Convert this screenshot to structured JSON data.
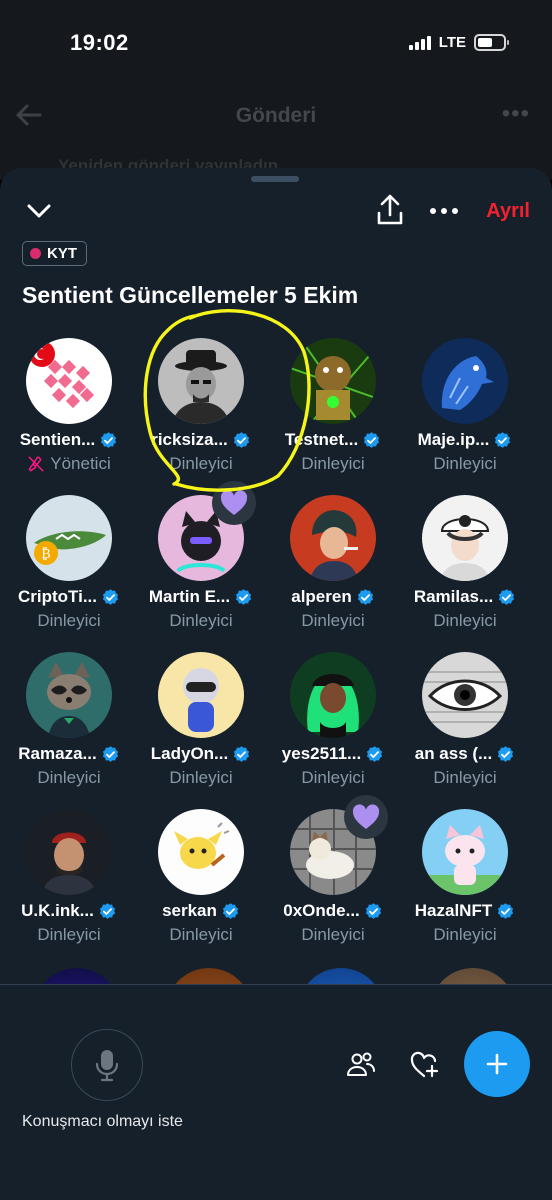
{
  "status_bar": {
    "time": "19:02",
    "network": "LTE"
  },
  "background_post": {
    "title": "Gönderi",
    "repost_text": "Yeniden gönderi yayınladın"
  },
  "space": {
    "leave_label": "Ayrıl",
    "badge": "KYT",
    "title": "Sentient Güncellemeler 5 Ekim"
  },
  "participants": [
    {
      "name": "Sentien...",
      "role": "Yönetici",
      "avatar": "sentient-logo"
    },
    {
      "name": "ricksiza...",
      "role": "Dinleyici",
      "avatar": "man-with-hat"
    },
    {
      "name": "Testnet...",
      "role": "Dinleyici",
      "avatar": "robot-bear"
    },
    {
      "name": "Maje.ip...",
      "role": "Dinleyici",
      "avatar": "blue-eagle"
    },
    {
      "name": "CriptoTi...",
      "role": "Dinleyici",
      "avatar": "crocodile-coin"
    },
    {
      "name": "Martin E...",
      "role": "Dinleyici",
      "avatar": "purple-cat"
    },
    {
      "name": "alperen",
      "role": "Dinleyici",
      "avatar": "anime-man"
    },
    {
      "name": "Ramilas...",
      "role": "Dinleyici",
      "avatar": "anime-cap-boy"
    },
    {
      "name": "Ramaza...",
      "role": "Dinleyici",
      "avatar": "raccoon-suit"
    },
    {
      "name": "LadyOn...",
      "role": "Dinleyici",
      "avatar": "robot-girl"
    },
    {
      "name": "yes2511...",
      "role": "Dinleyici",
      "avatar": "green-hair-girl"
    },
    {
      "name": "an ass (...",
      "role": "Dinleyici",
      "avatar": "eye-sketch"
    },
    {
      "name": "U.K.ink...",
      "role": "Dinleyici",
      "avatar": "man-beanie"
    },
    {
      "name": "serkan",
      "role": "Dinleyici",
      "avatar": "yellow-dog"
    },
    {
      "name": "0xOnde...",
      "role": "Dinleyici",
      "avatar": "cat-photo"
    },
    {
      "name": "HazalNFT",
      "role": "Dinleyici",
      "avatar": "pink-cat"
    }
  ],
  "bottom_bar": {
    "request_label": "Konuşmacı olmayı iste"
  },
  "colors": {
    "sheet": "#15202b",
    "accent": "#1d9bf0",
    "leave": "#f4212e",
    "annotation": "#f5f51a"
  }
}
